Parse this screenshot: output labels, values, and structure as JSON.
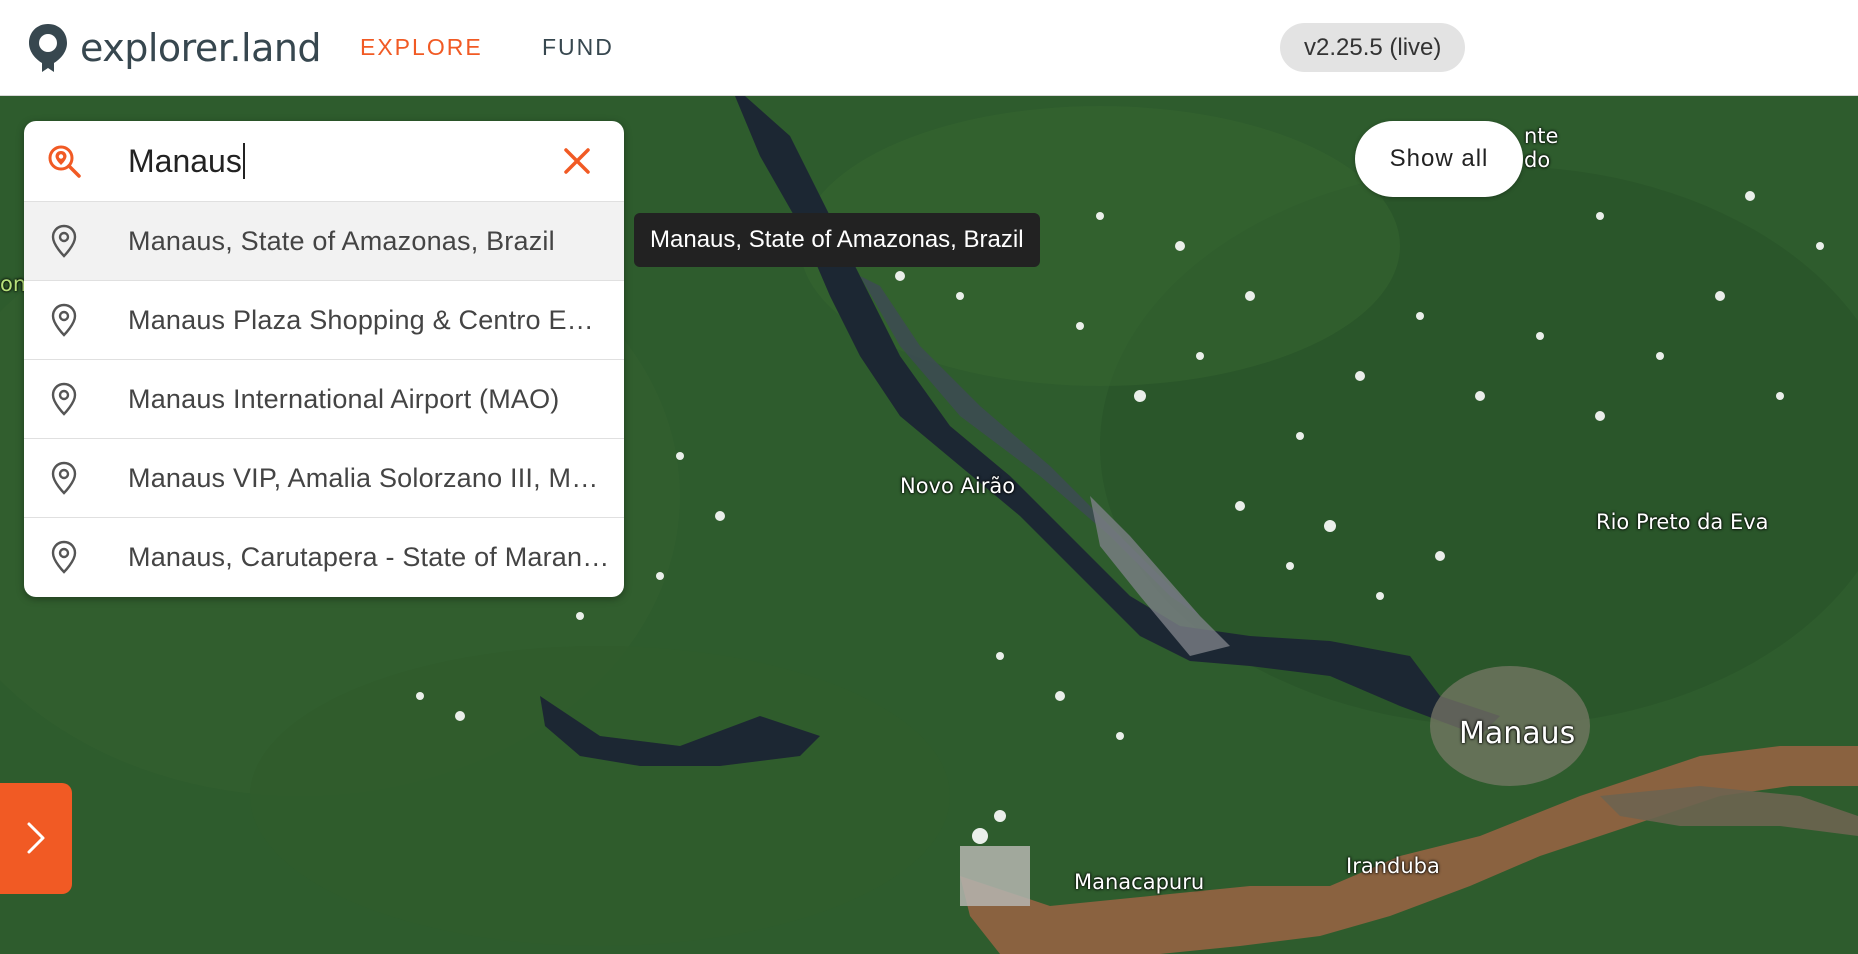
{
  "header": {
    "logo_text": "explorer.land",
    "nav": {
      "explore": "EXPLORE",
      "fund": "FUND"
    },
    "version": "v2.25.5 (live)"
  },
  "search": {
    "value": "Manaus",
    "placeholder": "",
    "results": [
      {
        "label": "Manaus, State of Amazonas, Brazil"
      },
      {
        "label": "Manaus Plaza Shopping & Centro Empresarial"
      },
      {
        "label": "Manaus International Airport (MAO)"
      },
      {
        "label": "Manaus VIP, Amalia Solorzano III, Mexico"
      },
      {
        "label": "Manaus, Carutapera - State of Maranhão, Brazil"
      }
    ]
  },
  "tooltip": "Manaus, State of Amazonas, Brazil",
  "show_all": "Show all",
  "map": {
    "labels": {
      "novo_airao": "Novo Airão",
      "rio_preto": "Rio Preto da Eva",
      "manaus": "Manaus",
      "manacapuru": "Manacapuru",
      "iranduba": "Iranduba",
      "partial_top_right": "nte\ndo",
      "partial_left": "on"
    }
  },
  "colors": {
    "accent": "#f15a24",
    "forest": "#2c5a2c",
    "river_dark": "#1b2430",
    "river_muddy": "#8a6240"
  },
  "icons": {
    "logo": "location-pin-logo-icon",
    "search": "map-search-icon",
    "clear": "close-icon",
    "result": "location-pin-icon",
    "toggle": "chevron-right-icon"
  }
}
